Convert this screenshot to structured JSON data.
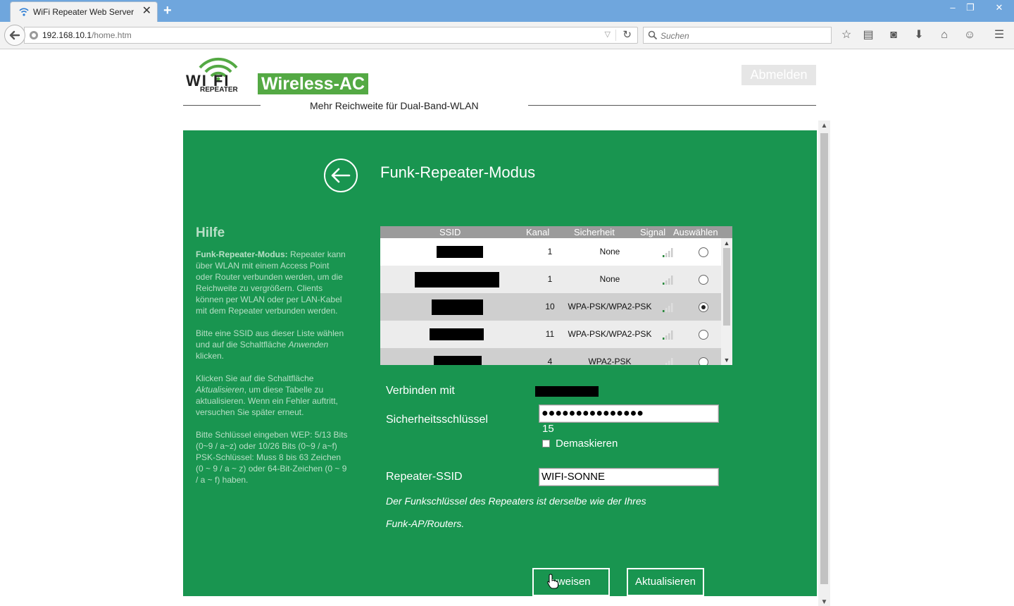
{
  "browser": {
    "tab_title": "WiFi Repeater Web Server",
    "tab_close": "✕",
    "new_tab": "+",
    "win_minimize": "–",
    "win_restore": "❐",
    "win_close": "✕",
    "url_host": "192.168.10.1",
    "url_path": "/home.htm",
    "search_placeholder": "Suchen"
  },
  "header": {
    "logo_text": "WI FI",
    "logo_sub": "REPEATER",
    "brand": "Wireless-AC",
    "tagline": "Mehr Reichweite für Dual-Band-WLAN",
    "logout_label": "Abmelden"
  },
  "panel": {
    "title": "Funk-Repeater-Modus",
    "accent_color": "#199550"
  },
  "help": {
    "heading": "Hilfe",
    "p1_bold": "Funk-Repeater-Modus:",
    "p1_text": " Repeater kann über WLAN mit einem Access Point oder Router verbunden werden, um die Reichweite zu vergrößern. Clients können per WLAN oder per LAN-Kabel mit dem Repeater verbunden werden.",
    "p2_a": "Bitte eine SSID aus dieser Liste wählen und auf die Schaltfläche ",
    "p2_em": "Anwenden",
    "p2_b": " klicken.",
    "p3_a": "Klicken Sie auf die Schaltfläche ",
    "p3_em": "Aktualisieren",
    "p3_b": ", um diese Tabelle zu aktualisieren. Wenn ein Fehler auftritt, versuchen Sie später erneut.",
    "p4_a": "Bitte Schlüssel eingeben WEP: 5/13 Bits (0~9 / a~z) oder 10/26 Bits (0~9 / a~f)",
    "p4_b": "PSK-Schlüssel: Muss 8 bis 63 Zeichen (0 ~ 9 / a ~ z) oder 64-Bit-Zeichen (0 ~ 9 / a ~ f) haben."
  },
  "table": {
    "headers": {
      "ssid": "SSID",
      "kanal": "Kanal",
      "sicherheit": "Sicherheit",
      "signal": "Signal",
      "auswahl": "Auswählen"
    },
    "rows": [
      {
        "kanal": "1",
        "sicherheit": "None",
        "signal_bars": 1,
        "selected": false
      },
      {
        "kanal": "1",
        "sicherheit": "None",
        "signal_bars": 1,
        "selected": false
      },
      {
        "kanal": "10",
        "sicherheit": "WPA-PSK/WPA2-PSK",
        "signal_bars": 1,
        "selected": true
      },
      {
        "kanal": "11",
        "sicherheit": "WPA-PSK/WPA2-PSK",
        "signal_bars": 1,
        "selected": false
      },
      {
        "kanal": "4",
        "sicherheit": "WPA2-PSK",
        "signal_bars": 0,
        "selected": false
      }
    ]
  },
  "form": {
    "connect_label": "Verbinden mit",
    "key_label": "Sicherheitsschlüssel",
    "key_value": "●●●●●●●●●●●●●●●",
    "key_length": "15",
    "unmask_label": "Demaskieren",
    "repeater_ssid_label": "Repeater-SSID",
    "repeater_ssid_value": "WIFI-SONNE",
    "note_line1": "Der Funkschlüssel des Repeaters ist derselbe wie der Ihres",
    "note_line2": "Funk-AP/Routers."
  },
  "buttons": {
    "apply_label": "uweisen",
    "refresh_label": "Aktualisieren"
  }
}
